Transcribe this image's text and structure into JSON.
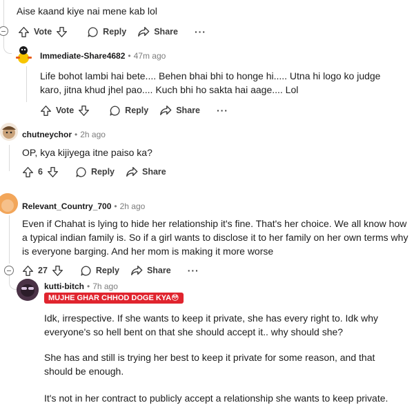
{
  "comments": [
    {
      "text": "Aise kaand kiye nai mene kab lol",
      "actions": {
        "vote": "Vote",
        "reply": "Reply",
        "share": "Share",
        "more": "···"
      }
    },
    {
      "username": "Immediate-Share4682",
      "time": "47m ago",
      "text": "Life bohot lambi hai bete.... Behen bhai bhi to honge hi..... Utna hi logo ko judge karo, jitna khud jhel pao.... Kuch bhi ho sakta hai aage.... Lol",
      "actions": {
        "vote": "Vote",
        "reply": "Reply",
        "share": "Share",
        "more": "···"
      }
    },
    {
      "username": "chutneychor",
      "time": "2h ago",
      "text": "OP, kya kijiyega itne paiso ka?",
      "actions": {
        "vote": "6",
        "reply": "Reply",
        "share": "Share"
      }
    },
    {
      "username": "Relevant_Country_700",
      "time": "2h ago",
      "text": "Even if Chahat is lying to hide her relationship it's fine. That's her choice. We all know how a typical indian family is. So if a girl wants to disclose it to her family on her own terms why is everyone barging. And her mom is making it more worse",
      "actions": {
        "vote": "27",
        "reply": "Reply",
        "share": "Share",
        "more": "···"
      }
    },
    {
      "username": "kutti-bitch",
      "time": "7h ago",
      "flair": "MUJHE GHAR CHHOD DOGE KYA😳",
      "paragraphs": [
        "Idk, irrespective. If she wants to keep it private, she has every right to. Idk why everyone's so hell bent on that she should accept it.. why should she?",
        "She has and still is trying her best to keep it private for some reason, and that should be enough.",
        "It's not in her contract to publicly accept a relationship she wants to keep private."
      ]
    }
  ],
  "colors": {
    "flair_bg": "#e0242e",
    "thread_line": "#d9d9d9",
    "meta_gray": "#7c7c7c"
  }
}
